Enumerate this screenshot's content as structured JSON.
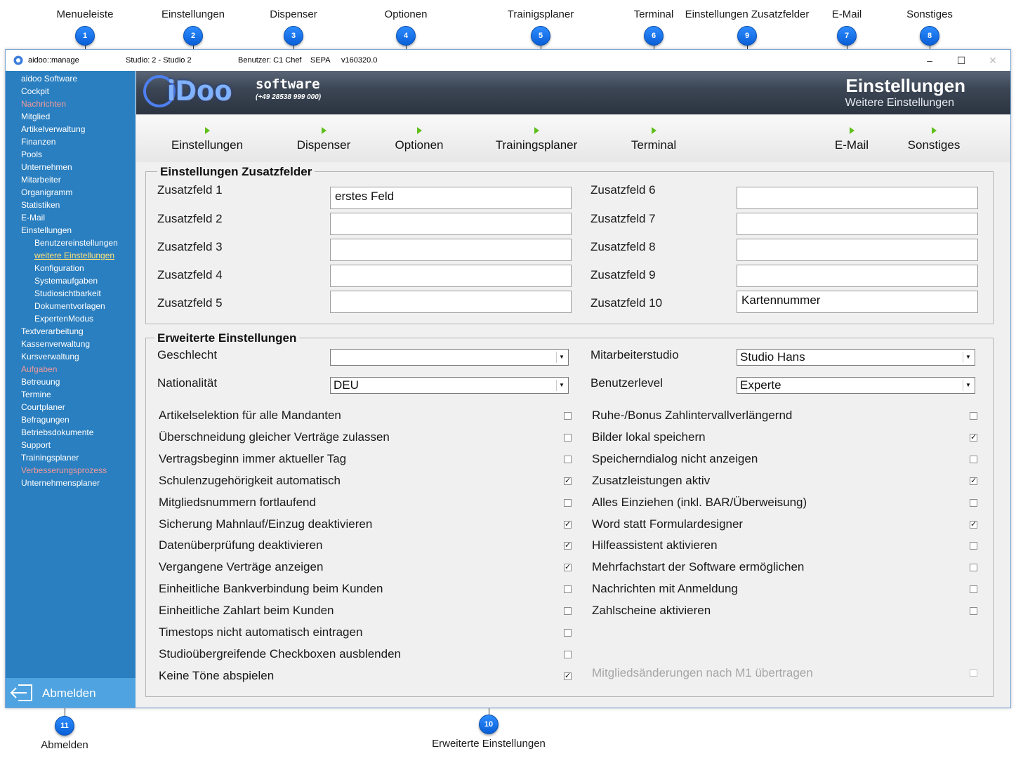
{
  "callouts": {
    "top": [
      {
        "num": "1",
        "label": "Menueleiste"
      },
      {
        "num": "2",
        "label": "Einstellungen"
      },
      {
        "num": "3",
        "label": "Dispenser"
      },
      {
        "num": "4",
        "label": "Optionen"
      },
      {
        "num": "5",
        "label": "Trainigsplaner"
      },
      {
        "num": "6",
        "label": "Terminal"
      },
      {
        "num": "9",
        "label": "Einstellungen Zusatzfelder"
      },
      {
        "num": "7",
        "label": "E-Mail"
      },
      {
        "num": "8",
        "label": "Sonstiges"
      }
    ],
    "bottom": [
      {
        "num": "11",
        "label": "Abmelden"
      },
      {
        "num": "10",
        "label": "Erweiterte Einstellungen"
      }
    ]
  },
  "titlebar": {
    "app": "aidoo::manage",
    "studio": "Studio: 2 - Studio 2",
    "user": "Benutzer: C1 Chef",
    "sepa": "SEPA",
    "version": "v160320.0",
    "minimize": "–",
    "maximize": "☐",
    "close": "✕"
  },
  "sidebar": {
    "items": [
      {
        "label": "aidoo Software",
        "style": "normal"
      },
      {
        "label": "Cockpit",
        "style": "normal"
      },
      {
        "label": "Nachrichten",
        "style": "red"
      },
      {
        "label": "Mitglied",
        "style": "normal"
      },
      {
        "label": "Artikelverwaltung",
        "style": "normal"
      },
      {
        "label": "Finanzen",
        "style": "normal"
      },
      {
        "label": "Pools",
        "style": "normal"
      },
      {
        "label": "Unternehmen",
        "style": "normal"
      },
      {
        "label": "Mitarbeiter",
        "style": "normal"
      },
      {
        "label": "Organigramm",
        "style": "normal"
      },
      {
        "label": "Statistiken",
        "style": "normal"
      },
      {
        "label": "E-Mail",
        "style": "normal"
      },
      {
        "label": "Einstellungen",
        "style": "normal"
      },
      {
        "label": "Benutzereinstellungen",
        "style": "sub"
      },
      {
        "label": "weitere Einstellungen",
        "style": "sub-active"
      },
      {
        "label": "Konfiguration",
        "style": "sub"
      },
      {
        "label": "Systemaufgaben",
        "style": "sub"
      },
      {
        "label": "Studiosichtbarkeit",
        "style": "sub"
      },
      {
        "label": "Dokumentvorlagen",
        "style": "sub"
      },
      {
        "label": "ExpertenModus",
        "style": "sub"
      },
      {
        "label": "Textverarbeitung",
        "style": "normal"
      },
      {
        "label": "Kassenverwaltung",
        "style": "normal"
      },
      {
        "label": "Kursverwaltung",
        "style": "normal"
      },
      {
        "label": "Aufgaben",
        "style": "red"
      },
      {
        "label": "Betreuung",
        "style": "normal"
      },
      {
        "label": "Termine",
        "style": "normal"
      },
      {
        "label": "Courtplaner",
        "style": "normal"
      },
      {
        "label": "Befragungen",
        "style": "normal"
      },
      {
        "label": "Betriebsdokumente",
        "style": "normal"
      },
      {
        "label": "Support",
        "style": "normal"
      },
      {
        "label": "Trainingsplaner",
        "style": "normal"
      },
      {
        "label": "Verbesserungsprozess",
        "style": "red"
      },
      {
        "label": "Unternehmensplaner",
        "style": "normal"
      }
    ],
    "logout_label": "Abmelden"
  },
  "header": {
    "logo_text": "iDoo",
    "logo_word": "software",
    "logo_phone": "(+49 28538 999 000)",
    "title": "Einstellungen",
    "subtitle": "Weitere Einstellungen"
  },
  "tabs": [
    {
      "label": "Einstellungen"
    },
    {
      "label": "Dispenser"
    },
    {
      "label": "Optionen"
    },
    {
      "label": "Trainingsplaner"
    },
    {
      "label": "Terminal"
    },
    {
      "label": "E-Mail"
    },
    {
      "label": "Sonstiges"
    }
  ],
  "zusatzfelder": {
    "title": "Einstellungen Zusatzfelder",
    "left": [
      {
        "label": "Zusatzfeld 1",
        "value": "erstes Feld"
      },
      {
        "label": "Zusatzfeld 2",
        "value": ""
      },
      {
        "label": "Zusatzfeld 3",
        "value": ""
      },
      {
        "label": "Zusatzfeld 4",
        "value": ""
      },
      {
        "label": "Zusatzfeld 5",
        "value": ""
      }
    ],
    "right": [
      {
        "label": "Zusatzfeld 6",
        "value": ""
      },
      {
        "label": "Zusatzfeld 7",
        "value": ""
      },
      {
        "label": "Zusatzfeld 8",
        "value": ""
      },
      {
        "label": "Zusatzfeld 9",
        "value": ""
      },
      {
        "label": "Zusatzfeld 10",
        "value": "Kartennummer"
      }
    ]
  },
  "erweitert": {
    "title": "Erweiterte Einstellungen",
    "selects": {
      "geschlecht": {
        "label": "Geschlecht",
        "value": ""
      },
      "nationalitaet": {
        "label": "Nationalität",
        "value": "DEU"
      },
      "mitarbeiterstudio": {
        "label": "Mitarbeiterstudio",
        "value": "Studio Hans"
      },
      "benutzerlevel": {
        "label": "Benutzerlevel",
        "value": "Experte"
      }
    },
    "left_checks": [
      {
        "label": "Artikelselektion für alle Mandanten",
        "checked": false
      },
      {
        "label": "Überschneidung gleicher Verträge zulassen",
        "checked": false
      },
      {
        "label": "Vertragsbeginn immer aktueller Tag",
        "checked": false
      },
      {
        "label": "Schulenzugehörigkeit automatisch",
        "checked": true
      },
      {
        "label": "Mitgliedsnummern fortlaufend",
        "checked": false
      },
      {
        "label": "Sicherung Mahnlauf/Einzug deaktivieren",
        "checked": true
      },
      {
        "label": "Datenüberprüfung deaktivieren",
        "checked": true
      },
      {
        "label": "Vergangene Verträge anzeigen",
        "checked": true
      },
      {
        "label": "Einheitliche Bankverbindung beim Kunden",
        "checked": false
      },
      {
        "label": "Einheitliche Zahlart beim Kunden",
        "checked": false
      },
      {
        "label": "Timestops nicht automatisch eintragen",
        "checked": false
      },
      {
        "label": "Studioübergreifende Checkboxen ausblenden",
        "checked": false
      },
      {
        "label": "Keine Töne abspielen",
        "checked": true
      }
    ],
    "right_checks": [
      {
        "label": "Ruhe-/Bonus Zahlintervallverlängernd",
        "checked": false
      },
      {
        "label": "Bilder lokal speichern",
        "checked": true
      },
      {
        "label": "Speicherndialog nicht anzeigen",
        "checked": false
      },
      {
        "label": "Zusatzleistungen aktiv",
        "checked": true
      },
      {
        "label": "Alles Einziehen (inkl. BAR/Überweisung)",
        "checked": false
      },
      {
        "label": "Word statt Formulardesigner",
        "checked": true
      },
      {
        "label": "Hilfeassistent aktivieren",
        "checked": false
      },
      {
        "label": "Mehrfachstart der Software ermöglichen",
        "checked": false
      },
      {
        "label": "Nachrichten mit Anmeldung",
        "checked": false
      },
      {
        "label": "Zahlscheine aktivieren",
        "checked": false
      }
    ],
    "disabled_check": {
      "label": "Mitgliedsänderungen nach M1 übertragen",
      "checked": false
    }
  }
}
